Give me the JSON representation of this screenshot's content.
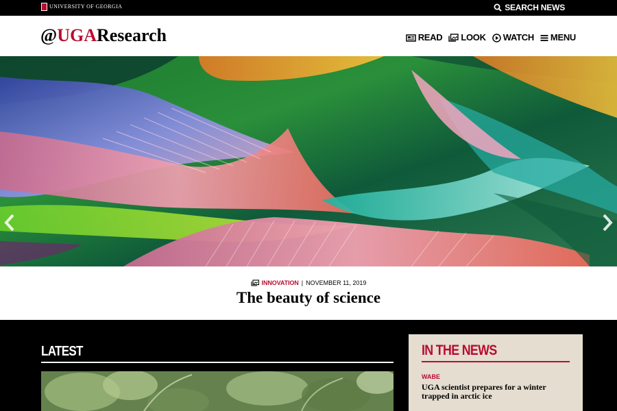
{
  "topbar": {
    "university": "UNIVERSITY OF GEORGIA",
    "search_label": "SEARCH NEWS",
    "search_icon": "magnifier-icon"
  },
  "header": {
    "logo_prefix": "@",
    "logo_brand": "UGA",
    "logo_suffix": "Research",
    "nav": [
      {
        "label": "READ",
        "icon": "newspaper-icon"
      },
      {
        "label": "LOOK",
        "icon": "photos-icon"
      },
      {
        "label": "WATCH",
        "icon": "play-circle-icon"
      },
      {
        "label": "MENU",
        "icon": "hamburger-icon"
      }
    ]
  },
  "feature": {
    "category": "INNOVATION",
    "separator": "|",
    "date": "NOVEMBER 11, 2019",
    "title": "The beauty of science"
  },
  "latest": {
    "heading": "LATEST"
  },
  "in_the_news": {
    "heading": "IN THE NEWS",
    "source": "WABE",
    "title": "UGA scientist prepares for a winter trapped in arctic ice"
  },
  "colors": {
    "brand_red": "#ba0c2f",
    "news_box_bg": "#e4ddd0",
    "page_bg": "#000000"
  }
}
